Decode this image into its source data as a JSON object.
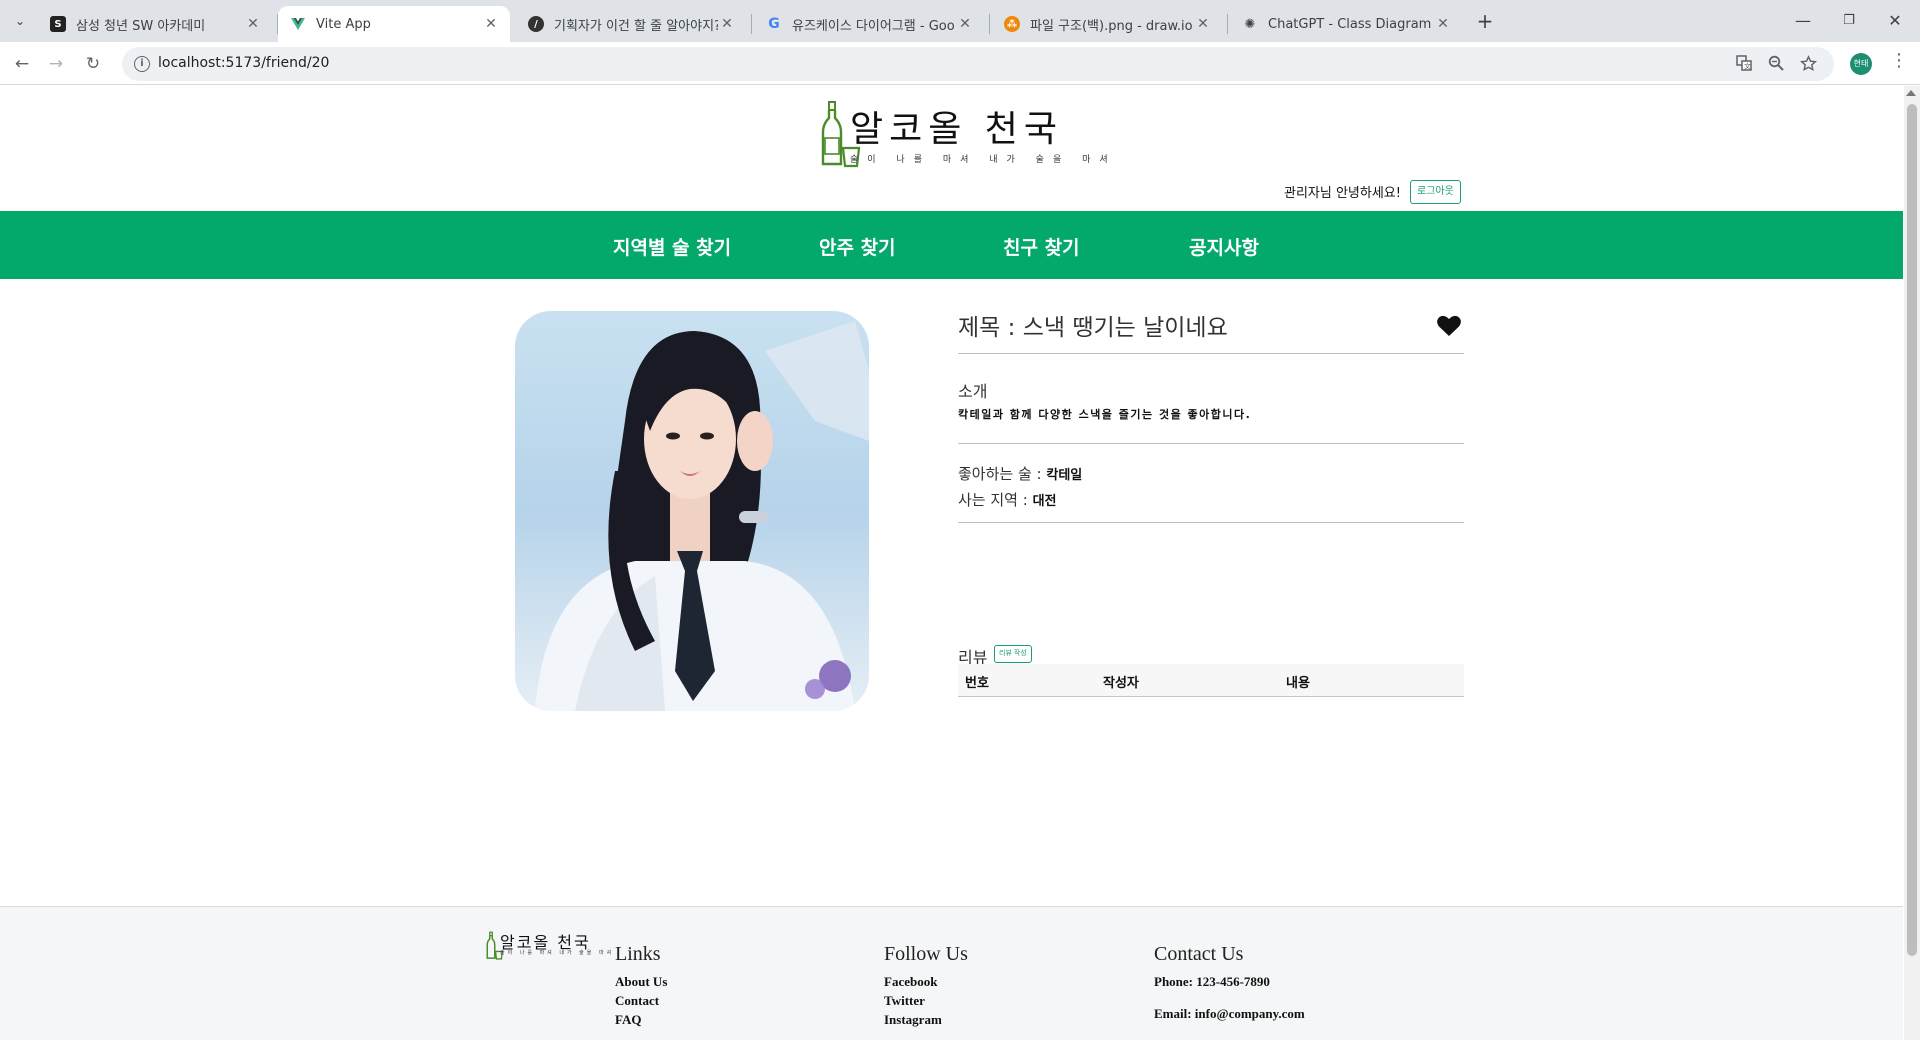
{
  "browser": {
    "tabs": [
      {
        "title": "삼성 청년 SW 아카데미",
        "favicon": "ssafy-favicon"
      },
      {
        "title": "Vite App",
        "favicon": "vite-favicon"
      },
      {
        "title": "기획자가 이건 할 줄 알아야지?",
        "favicon": "velog-favicon"
      },
      {
        "title": "유즈케이스 다이어그램 - Goo",
        "favicon": "google-favicon"
      },
      {
        "title": "파일 구조(백).png - draw.io",
        "favicon": "drawio-favicon"
      },
      {
        "title": "ChatGPT - Class Diagram Crea",
        "favicon": "chatgpt-favicon"
      }
    ],
    "url": "localhost:5173/friend/20",
    "profile_initial": "현태"
  },
  "header": {
    "logo_title": "알코올 천국",
    "logo_subtitle": "술이 나를 마셔 내가 술을 마셔",
    "greeting": "관리자님 안녕하세요!",
    "logout_label": "로그아웃"
  },
  "nav": {
    "items": [
      "지역별 술 찾기",
      "안주 찾기",
      "친구 찾기",
      "공지사항"
    ]
  },
  "detail": {
    "title": "제목 : 스낵 땡기는 날이네요",
    "intro_label": "소개",
    "intro_text": "칵테일과 함께 다양한 스낵을 즐기는 것을 좋아합니다.",
    "favorite_drink_label": "좋아하는 술 : ",
    "favorite_drink_value": "칵테일",
    "region_label": "사는 지역 : ",
    "region_value": "대전",
    "review_label": "리뷰",
    "review_write_label": "리뷰 작성",
    "review_columns": [
      "번호",
      "작성자",
      "내용"
    ]
  },
  "footer": {
    "logo_title": "알코올 천국",
    "logo_subtitle": "술이 나를 마셔 내가 술을 마셔",
    "links_heading": "Links",
    "links": [
      "About Us",
      "Contact",
      "FAQ"
    ],
    "follow_heading": "Follow Us",
    "follow": [
      "Facebook",
      "Twitter",
      "Instagram"
    ],
    "contact_heading": "Contact Us",
    "phone": "Phone: 123-456-7890",
    "email": "Email: info@company.com"
  },
  "colors": {
    "brand_green": "#03a96b",
    "accent_green": "#1aa06d"
  }
}
